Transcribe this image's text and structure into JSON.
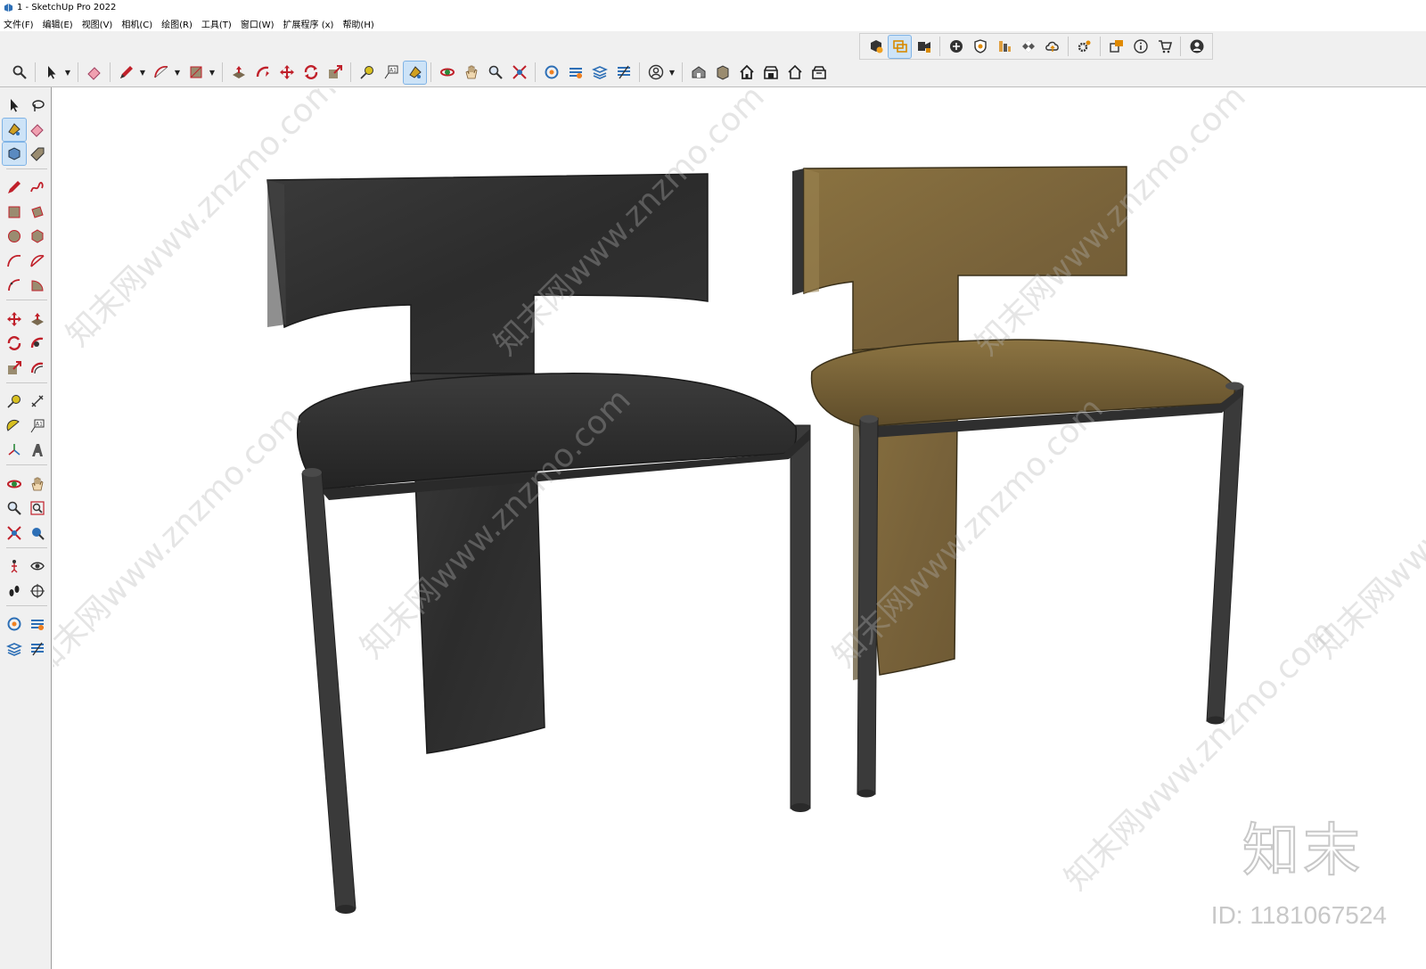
{
  "window": {
    "title": "1 - SketchUp Pro 2022"
  },
  "menu": [
    {
      "label": "文件(F)"
    },
    {
      "label": "编辑(E)"
    },
    {
      "label": "视图(V)"
    },
    {
      "label": "相机(C)"
    },
    {
      "label": "绘图(R)"
    },
    {
      "label": "工具(T)"
    },
    {
      "label": "窗口(W)"
    },
    {
      "label": "扩展程序 (x)"
    },
    {
      "label": "帮助(H)"
    }
  ],
  "colors": {
    "chair_dark": "#2e2e2e",
    "chair_olive": "#7a6538",
    "legs": "#3a3a3a",
    "toolbar_bg": "#f0f0f0",
    "active_tool": "#cde3f7"
  },
  "toolbars": {
    "top_icons": [
      "component-icon",
      "select-scene-icon",
      "video-icon",
      "add-location-icon",
      "shield-icon",
      "layers-icon",
      "checker-icon",
      "cloud-icon",
      "extension-gear-icon",
      "scene-chat-icon",
      "info-icon",
      "cart-icon",
      "account-icon"
    ],
    "main_icons": [
      "search-icon",
      "select-icon",
      "eraser-icon",
      "pencil-icon",
      "arc-icon",
      "rectangle-icon",
      "pushpull-icon",
      "followme-icon",
      "move-icon",
      "rotate-icon",
      "scale-icon",
      "tape-icon",
      "text-icon",
      "paint-icon",
      "orbit-icon",
      "pan-icon",
      "zoom-icon",
      "zoom-extents-icon",
      "section-icon",
      "section-fill-icon",
      "section-display-icon",
      "section-cut-icon",
      "user-icon",
      "warehouse-icon",
      "extension-warehouse-icon",
      "home-icon",
      "house-front-icon",
      "house-outline-icon",
      "house-gallery-icon"
    ]
  },
  "watermark": {
    "tiles": [
      "知末网www.znzmo.com",
      "知末网www.znzmo.com",
      "知末网www.znzmo.com",
      "知末网www.znzmo.com",
      "知末网www.znzmo.com",
      "知末网www.znzmo.com",
      "知末网www.znzmo.com",
      "知末网www.znzmo.com"
    ],
    "logo_text": "知末",
    "id_text": "ID: 1181067524"
  }
}
